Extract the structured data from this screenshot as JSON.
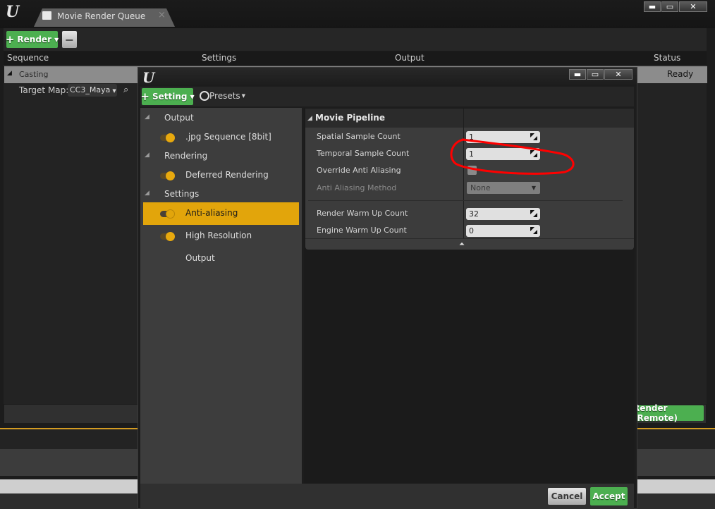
{
  "window": {
    "logo": "U",
    "tab_label": "Movie Render Queue",
    "tab_close": "×",
    "minimize": "▬",
    "maximize": "▭",
    "close": "✕"
  },
  "toolbar": {
    "render_label": "Render",
    "render_plus": "+",
    "remove_label": "−"
  },
  "queue": {
    "columns": [
      "Sequence",
      "Settings",
      "Output",
      "Status"
    ],
    "job": {
      "name": "Casting",
      "status": "Ready",
      "target_map_label": "Target Map:",
      "target_map_value": "CC3_Maya"
    },
    "render_remote_label": "Render (Remote)"
  },
  "dialog": {
    "logo": "U",
    "setting_label": "Setting",
    "presets_label": "Presets",
    "tree": [
      {
        "type": "category",
        "label": "Output"
      },
      {
        "type": "item",
        "label": ".jpg Sequence [8bit]",
        "enabled": true
      },
      {
        "type": "category",
        "label": "Rendering"
      },
      {
        "type": "item",
        "label": "Deferred Rendering",
        "enabled": true
      },
      {
        "type": "category",
        "label": "Settings"
      },
      {
        "type": "item",
        "label": "Anti-aliasing",
        "enabled": true,
        "selected": true
      },
      {
        "type": "item",
        "label": "High Resolution",
        "enabled": true
      },
      {
        "type": "item",
        "label": "Output",
        "enabled": null
      }
    ],
    "details": {
      "section": "Movie Pipeline",
      "properties": [
        {
          "label": "Spatial Sample Count",
          "value": "1",
          "kind": "number"
        },
        {
          "label": "Temporal Sample Count",
          "value": "1",
          "kind": "number"
        },
        {
          "label": "Override Anti Aliasing",
          "value": false,
          "kind": "checkbox"
        },
        {
          "label": "Anti Aliasing Method",
          "value": "None",
          "kind": "dropdown",
          "disabled": true
        },
        {
          "label": "Render Warm Up Count",
          "value": "32",
          "kind": "number"
        },
        {
          "label": "Engine Warm Up Count",
          "value": "0",
          "kind": "number"
        }
      ]
    },
    "cancel_label": "Cancel",
    "accept_label": "Accept"
  },
  "colors": {
    "accent_green": "#4caf50",
    "selection_gold": "#e2a50b",
    "annotation_red": "#ff0000"
  }
}
